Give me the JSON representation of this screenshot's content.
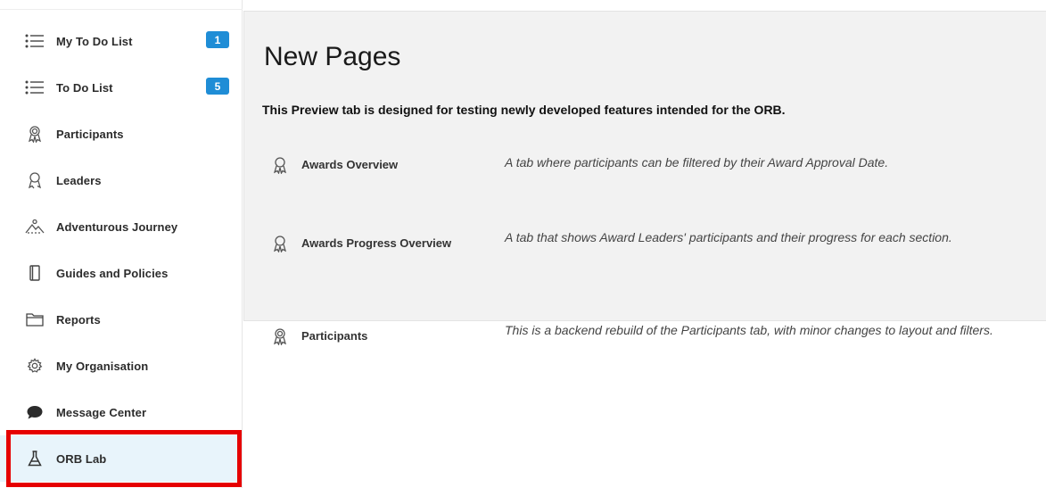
{
  "sidebar": {
    "items": [
      {
        "label": "My To Do List",
        "icon": "list-icon",
        "badge": "1"
      },
      {
        "label": "To Do List",
        "icon": "list-icon",
        "badge": "5"
      },
      {
        "label": "Participants",
        "icon": "award-ribbon-icon"
      },
      {
        "label": "Leaders",
        "icon": "person-award-icon"
      },
      {
        "label": "Adventurous Journey",
        "icon": "mountain-icon"
      },
      {
        "label": "Guides and Policies",
        "icon": "book-icon"
      },
      {
        "label": "Reports",
        "icon": "folder-icon"
      },
      {
        "label": "My Organisation",
        "icon": "gear-icon"
      },
      {
        "label": "Message Center",
        "icon": "chat-bubble-icon"
      },
      {
        "label": "ORB Lab",
        "icon": "flask-icon",
        "active": true
      }
    ]
  },
  "main": {
    "title": "New Pages",
    "subtitle": "This Preview tab is designed for testing newly developed features intended for the ORB.",
    "features": [
      {
        "name": "Awards Overview",
        "icon": "award-icon",
        "description": "A tab where participants can be filtered by their Award Approval Date."
      },
      {
        "name": "Awards Progress Overview",
        "icon": "award-icon",
        "description": "A tab that shows Award Leaders' participants and their progress for each section."
      },
      {
        "name": "Participants",
        "icon": "award-ribbon-icon",
        "description": "This is a backend rebuild of the Participants tab, with minor changes to layout and filters."
      }
    ]
  },
  "colors": {
    "badge": "#1f8dd6",
    "active_bg": "#e8f4fb",
    "highlight_border": "#e60000",
    "panel_bg": "#f2f2f2"
  }
}
